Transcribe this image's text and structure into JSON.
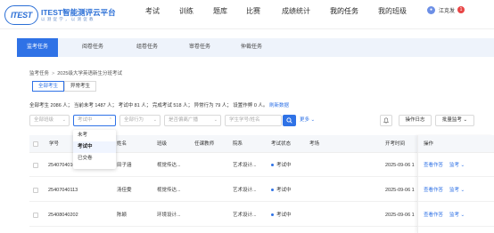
{
  "logo": {
    "mark": "ITEST",
    "title": "ITEST智能测评云平台",
    "sub": "以 测 促 学 ， 以 测 促 教"
  },
  "nav": [
    {
      "label": "考试"
    },
    {
      "label": "训练"
    },
    {
      "label": "题库"
    },
    {
      "label": "比赛"
    },
    {
      "label": "成绩统计"
    },
    {
      "label": "我的任务"
    },
    {
      "label": "我的班级"
    }
  ],
  "user": {
    "name": "江克发",
    "badge": "1"
  },
  "tabs": [
    {
      "label": "监考任务"
    },
    {
      "label": "阅卷任务"
    },
    {
      "label": "组卷任务"
    },
    {
      "label": "审卷任务"
    },
    {
      "label": "仲裁任务"
    }
  ],
  "breadcrumb": {
    "parent": "监考任务",
    "sep": ">",
    "current": "2025级大学英语新生分班考试"
  },
  "subtabs": [
    {
      "label": "全部考生"
    },
    {
      "label": "异常考生"
    }
  ],
  "stats": {
    "text": "全部考生 2086 人； 当前未考 1487 人； 考试中 81 人； 完成考试 518 人； 异常行为 79 人； 设置作弊 0 人。",
    "refresh": "刷新数据"
  },
  "filters": {
    "class": "全部班级",
    "status": "考试中",
    "behavior": "全部行为",
    "tag": "是否偏离广播",
    "search_placeholder": "学生学号/姓名",
    "more": "更多",
    "log": "操作日志",
    "batch": "批量监考"
  },
  "status_options": [
    "未考",
    "考试中",
    "已交卷"
  ],
  "table": {
    "headers": [
      "学号",
      "姓名",
      "班级",
      "任课教师",
      "院系",
      "考试状态",
      "考场",
      "开考时间",
      "操作"
    ],
    "rows": [
      {
        "id": "25407040101",
        "name": "田子涵",
        "cls": "视觉传达...",
        "teacher": "",
        "dept": "艺术设计...",
        "status": "考试中",
        "room": "",
        "time": "2025-09-06 1",
        "a1": "查看作答",
        "a2": "监考"
      },
      {
        "id": "25407040113",
        "name": "汤佳雯",
        "cls": "视觉传达...",
        "teacher": "",
        "dept": "艺术设计...",
        "status": "考试中",
        "room": "",
        "time": "2025-09-06 1",
        "a1": "查看作答",
        "a2": "监考"
      },
      {
        "id": "25408040202",
        "name": "陈颖",
        "cls": "环境设计...",
        "teacher": "",
        "dept": "艺术设计...",
        "status": "考试中",
        "room": "",
        "time": "2025-09-06 1",
        "a1": "查看作答",
        "a2": "监考"
      }
    ]
  }
}
